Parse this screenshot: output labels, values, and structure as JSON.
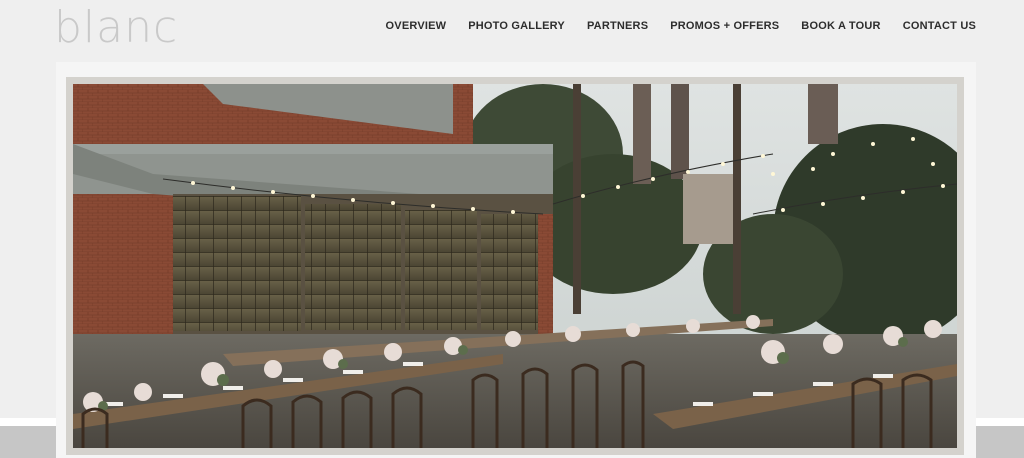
{
  "brand": {
    "logo_text": "blanc"
  },
  "nav": {
    "items": [
      {
        "label": "OVERVIEW"
      },
      {
        "label": "PHOTO GALLERY"
      },
      {
        "label": "PARTNERS"
      },
      {
        "label": "PROMOS + OFFERS"
      },
      {
        "label": "BOOK A TOUR"
      },
      {
        "label": "CONTACT US"
      }
    ]
  },
  "hero": {
    "image": "outdoor-wedding-reception-photo"
  },
  "colors": {
    "background": "#efefef",
    "nav_text": "#2d2d2d",
    "logo": "#c9c9c9",
    "frame": "#d4d2cd"
  }
}
